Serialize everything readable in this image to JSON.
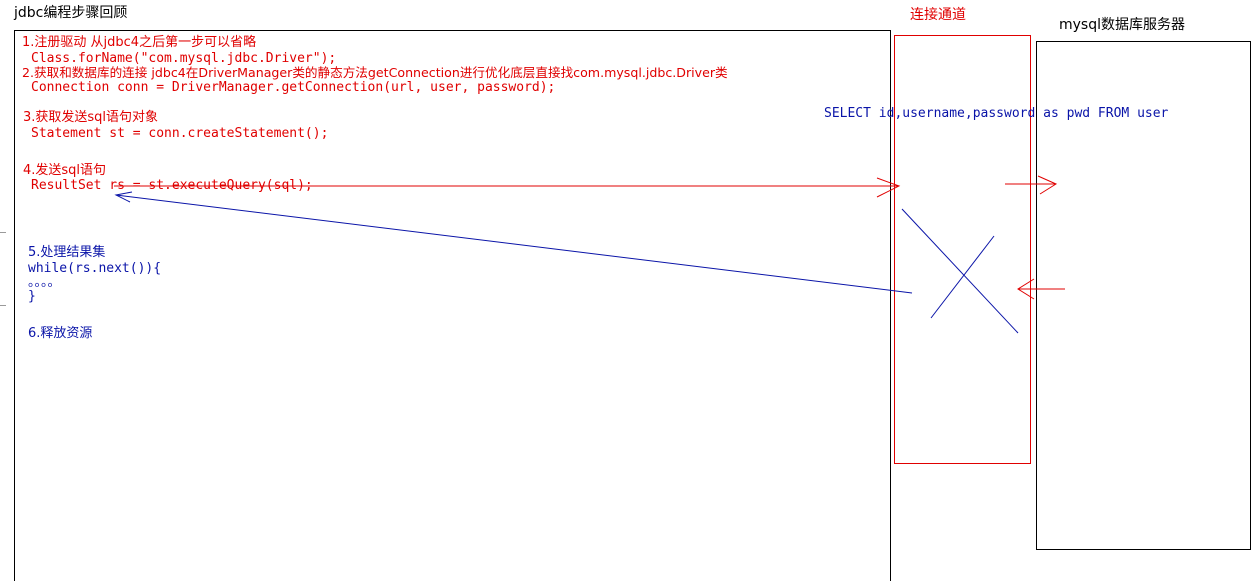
{
  "page_title": "jdbc编程步骤回顾",
  "channel_label": "连接通道",
  "server_label": "mysql数据库服务器",
  "sql_statement": "SELECT id,username,password as pwd FROM user",
  "steps": {
    "step1_title": "1.注册驱动 从jdbc4之后第一步可以省略",
    "step1_code": "Class.forName(\"com.mysql.jdbc.Driver\");",
    "step2_title": "2.获取和数据库的连接 jdbc4在DriverManager类的静态方法getConnection进行优化底层直接找com.mysql.jdbc.Driver类",
    "step2_code": "Connection conn = DriverManager.getConnection(url, user, password);",
    "step3_title": "3.获取发送sql语句对象",
    "step3_code": "Statement st = conn.createStatement();",
    "step4_title": "4.发送sql语句",
    "step4_code": "ResultSet rs = st.executeQuery(sql);",
    "step5_title": "5.处理结果集",
    "step5_code1": "while(rs.next()){",
    "step5_code2": "。。。。",
    "step5_code3": "}",
    "step6_title": "6.释放资源"
  },
  "colors": {
    "red": "#e00000",
    "blue": "#0a14a8",
    "black": "#000000"
  }
}
